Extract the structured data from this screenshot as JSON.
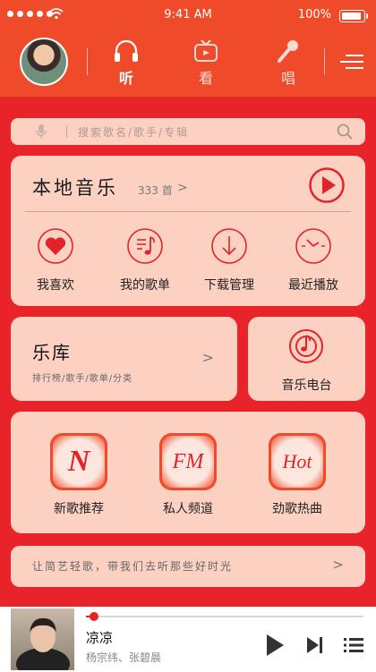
{
  "status_bar": {
    "time": "9:41 AM",
    "battery": "100%"
  },
  "header": {
    "tabs": [
      {
        "label": "听",
        "icon": "headphones-icon",
        "active": true
      },
      {
        "label": "看",
        "icon": "tv-icon",
        "active": false
      },
      {
        "label": "唱",
        "icon": "microphone-icon",
        "active": false
      }
    ]
  },
  "search": {
    "placeholder": "搜索歌名/歌手/专辑"
  },
  "local_music": {
    "title": "本地音乐",
    "count": "333 首",
    "arrow": ">",
    "actions": [
      {
        "label": "我喜欢",
        "icon": "heart-icon"
      },
      {
        "label": "我的歌单",
        "icon": "playlist-icon"
      },
      {
        "label": "下载管理",
        "icon": "download-icon"
      },
      {
        "label": "最近播放",
        "icon": "clock-icon"
      }
    ]
  },
  "library": {
    "title": "乐库",
    "subtitle": "排行榜/歌手/歌单/分类",
    "arrow": ">"
  },
  "radio": {
    "label": "音乐电台"
  },
  "channels": [
    {
      "badge": "N",
      "label": "新歌推荐"
    },
    {
      "badge": "FM",
      "label": "私人频道"
    },
    {
      "badge": "Hot",
      "label": "劲歌热曲"
    }
  ],
  "slogan": {
    "text": "让简艺轻歌，带我们去听那些好时光",
    "arrow": ">"
  },
  "player": {
    "song": "凉凉",
    "artist": "杨宗纬、张碧晨",
    "progress": 0.03
  },
  "colors": {
    "primary": "#e9232a",
    "header": "#ef4b2b",
    "card": "#fcd1c2"
  }
}
